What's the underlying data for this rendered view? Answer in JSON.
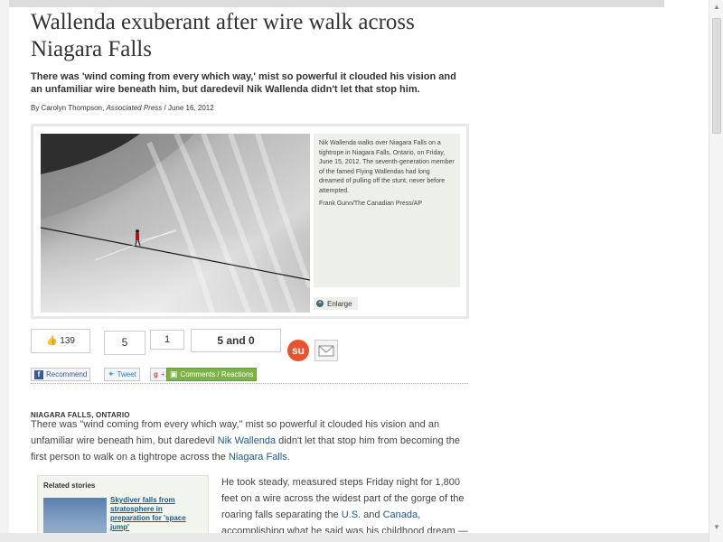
{
  "article": {
    "headline": "Wallenda exuberant after wire walk across Niagara Falls",
    "subhead": "There was 'wind coming from every which way,' mist so powerful it clouded his vision and an unfamiliar wire beneath him, but daredevil Nik Wallenda didn't let that stop him.",
    "byline_author": "By Carolyn Thompson,",
    "byline_source": "Associated Press",
    "byline_date": "/ June 16, 2012"
  },
  "photo": {
    "caption": "Nik Wallenda walks over Niagara Falls on a tightrope in Niagara Falls, Ontario, on Friday, June 15, 2012. The seventh-generation member of the famed Flying Wallendas had long dreamed of pulling off the stunt, never before attempted.",
    "credit": "Frank Gunn/The Canadian Press/AP",
    "enlarge_label": "Enlarge"
  },
  "share": {
    "like_count": "139",
    "tweet_count": "5",
    "plus_count": "1",
    "comments_count": "5 and 0",
    "recommend_label": "Recommend",
    "tweet_label": "Tweet",
    "plusone_label": "+1",
    "comments_label": "Comments / Reactions"
  },
  "body": {
    "dateline": "NIAGARA FALLS, ONTARIO",
    "p1_a": "There was \"wind coming from every which way,\" mist so powerful it clouded his vision and an unfamiliar wire beneath him, but daredevil ",
    "p1_link1": "Nik Wallenda",
    "p1_b": " didn't let that stop him from becoming the first person to walk on a tightrope across the ",
    "p1_link2": "Niagara Falls",
    "p1_c": ".",
    "p2_a": "He took steady, measured steps Friday night for 1,800 feet on a wire across the widest part of the gorge of the roaring falls separating the ",
    "p2_link1": "U.S.",
    "p2_b": " and ",
    "p2_link2": "Canada",
    "p2_c": ", accomplishing what he said was his childhood dream —"
  },
  "related": {
    "title": "Related stories",
    "item1": "Skydiver falls from stratosphere in preparation for 'space jump'"
  }
}
